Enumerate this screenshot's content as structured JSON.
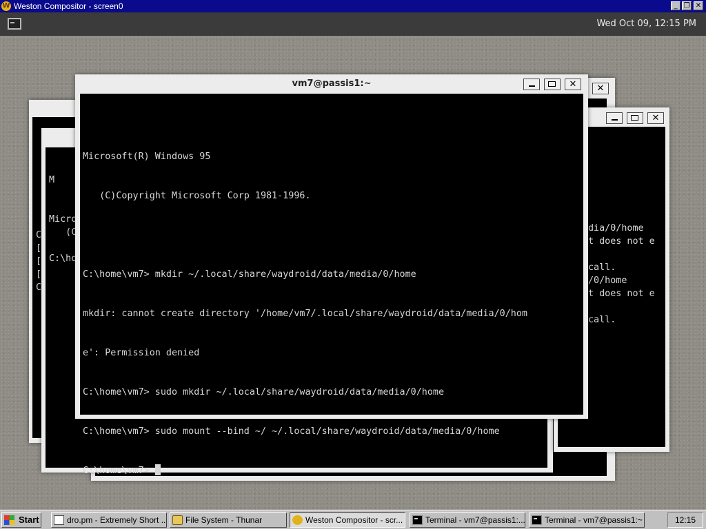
{
  "outer_window": {
    "title": "Weston Compositor - screen0",
    "minimize_glyph": "_",
    "restore_glyph": "❐",
    "close_glyph": "✕"
  },
  "panel": {
    "launcher_icon": "terminal-icon",
    "clock": "Wed Oct 09, 12:15 PM"
  },
  "main_terminal": {
    "title": "vm7@passis1:~",
    "close_glyph": "✕",
    "lines": [
      "Microsoft(R) Windows 95",
      "   (C)Copyright Microsoft Corp 1981-1996.",
      "",
      "C:\\home\\vm7> mkdir ~/.local/share/waydroid/data/media/0/home",
      "mkdir: cannot create directory '/home/vm7/.local/share/waydroid/data/media/0/hom",
      "e': Permission denied",
      "C:\\home\\vm7> sudo mkdir ~/.local/share/waydroid/data/media/0/home",
      "C:\\home\\vm7> sudo mount --bind ~/ ~/.local/share/waydroid/data/media/0/home"
    ],
    "prompt": "C:\\home\\vm7> "
  },
  "right_terminal": {
    "close_glyph": "✕",
    "lines": [
      "dia/0/home",
      "t does not e",
      "",
      "call.",
      "/0/home",
      "t does not e",
      "",
      "call."
    ]
  },
  "back_terminal": {
    "close_glyph": "✕"
  },
  "left_terminal": {
    "lines": [
      "M",
      "",
      "",
      "Micro",
      "   (C",
      "",
      "C:\\ho"
    ],
    "lines_far": [
      "C",
      "[",
      "[",
      "[",
      "C"
    ]
  },
  "taskbar": {
    "start_label": "Start",
    "items": [
      {
        "label": "dro.pm - Extremely Short ...",
        "icon": "document-icon"
      },
      {
        "label": "File System - Thunar",
        "icon": "folder-icon"
      },
      {
        "label": "Weston Compositor - scr...",
        "icon": "wayland-icon"
      },
      {
        "label": "Terminal - vm7@passis1:...",
        "icon": "terminal-icon"
      },
      {
        "label": "Terminal - vm7@passis1:~",
        "icon": "terminal-icon"
      }
    ],
    "clock": "12:15"
  }
}
